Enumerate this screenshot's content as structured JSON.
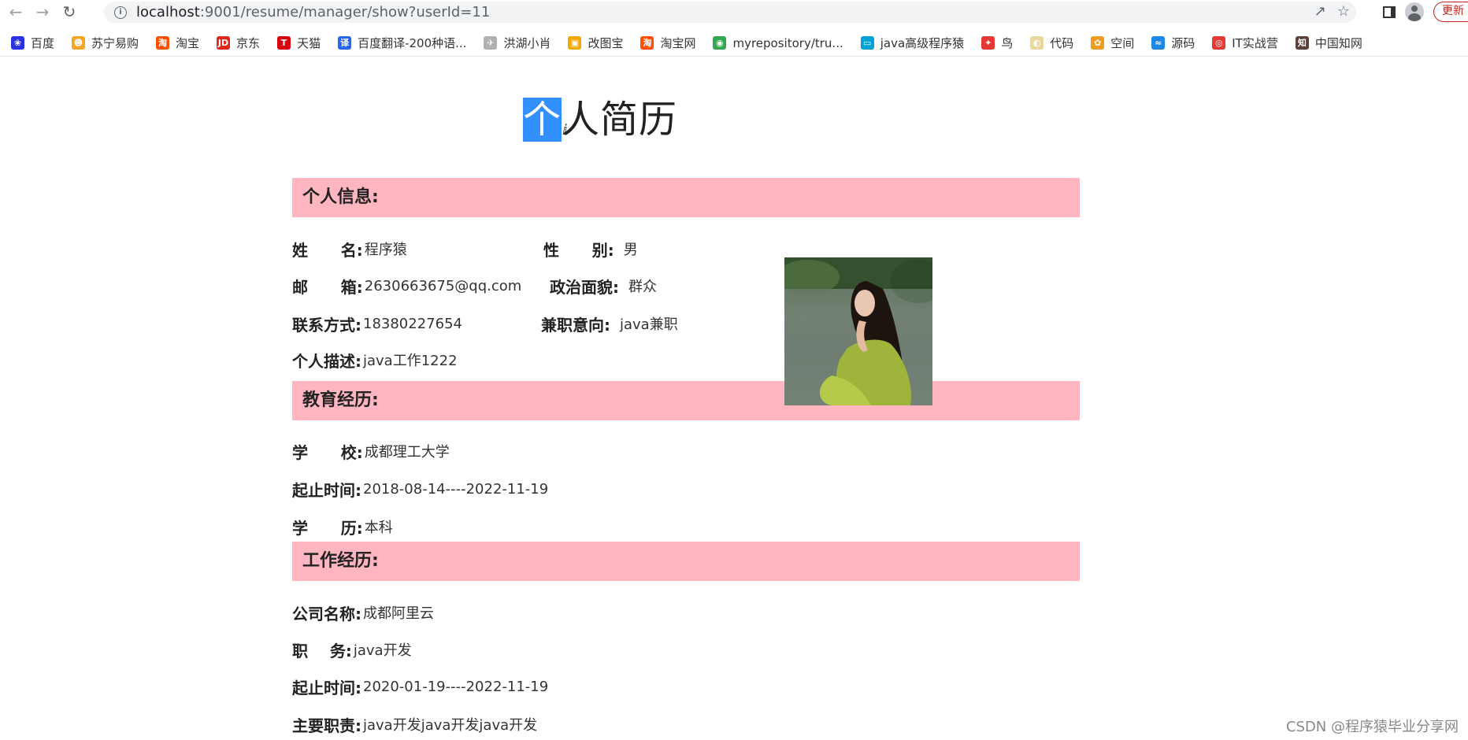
{
  "browser": {
    "url_host": "localhost",
    "url_rest": ":9001/resume/manager/show?userId=11",
    "update_label": "更新"
  },
  "bookmarks": [
    {
      "label": "百度",
      "icon": "baidu-paw-icon",
      "color": "#2932e1",
      "glyph": "❀"
    },
    {
      "label": "苏宁易购",
      "icon": "suning-lion-icon",
      "color": "#f5a623",
      "glyph": "☻"
    },
    {
      "label": "淘宝",
      "icon": "taobao-icon",
      "color": "#ff5000",
      "glyph": "淘"
    },
    {
      "label": "京东",
      "icon": "jd-icon",
      "color": "#e1251b",
      "glyph": "JD"
    },
    {
      "label": "天猫",
      "icon": "tmall-icon",
      "color": "#d8000f",
      "glyph": "T"
    },
    {
      "label": "百度翻译-200种语...",
      "icon": "baidu-translate-icon",
      "color": "#2468f2",
      "glyph": "译"
    },
    {
      "label": "洪湖小肖",
      "icon": "bird-icon",
      "color": "#b0b0b0",
      "glyph": "✈"
    },
    {
      "label": "改图宝",
      "icon": "gaitubao-icon",
      "color": "#f7a600",
      "glyph": "▣"
    },
    {
      "label": "淘宝网",
      "icon": "taobao-web-icon",
      "color": "#ff5000",
      "glyph": "淘"
    },
    {
      "label": "myrepository/tru...",
      "icon": "chrome-icon",
      "color": "#34a853",
      "glyph": "◉"
    },
    {
      "label": "java高级程序猿",
      "icon": "bilibili-tv-icon",
      "color": "#00a1d6",
      "glyph": "▭"
    },
    {
      "label": "鸟",
      "icon": "red-bird-icon",
      "color": "#e53935",
      "glyph": "✦"
    },
    {
      "label": "代码",
      "icon": "code-icon",
      "color": "#e8d8a0",
      "glyph": "◐"
    },
    {
      "label": "空间",
      "icon": "qzone-icon",
      "color": "#f29c1f",
      "glyph": "✿"
    },
    {
      "label": "源码",
      "icon": "source-fish-icon",
      "color": "#1e88e5",
      "glyph": "≈"
    },
    {
      "label": "IT实战营",
      "icon": "it-camp-icon",
      "color": "#e53935",
      "glyph": "◎"
    },
    {
      "label": "中国知网",
      "icon": "cnki-icon",
      "color": "#5d4037",
      "glyph": "知"
    }
  ],
  "page": {
    "title_highlight": "个",
    "title_rest": "人简历"
  },
  "personal": {
    "header": "个人信息:",
    "name_label": "姓      名:",
    "name_value": "程序猿",
    "gender_label": "性      别:",
    "gender_value": "男",
    "email_label": "邮      箱:",
    "email_value": "2630663675@qq.com",
    "political_label": "政治面貌:",
    "political_value": "群众",
    "contact_label": "联系方式:",
    "contact_value": "18380227654",
    "parttime_label": "兼职意向:",
    "parttime_value": "java兼职",
    "desc_label": "个人描述:",
    "desc_value": "java工作1222"
  },
  "education": {
    "header": "教育经历:",
    "school_label": "学      校:",
    "school_value": "成都理工大学",
    "period_label": "起止时间:",
    "period_value": "2018-08-14----2022-11-19",
    "degree_label": "学      历:",
    "degree_value": "本科"
  },
  "work": {
    "header": "工作经历:",
    "company_label": "公司名称:",
    "company_value": "成都阿里云",
    "position_label": "职    务:",
    "position_value": "java开发",
    "period_label": "起止时间:",
    "period_value": "2020-01-19----2022-11-19",
    "duty_label": "主要职责:",
    "duty_value": "java开发java开发java开发"
  },
  "watermark": "CSDN @程序猿毕业分享网"
}
